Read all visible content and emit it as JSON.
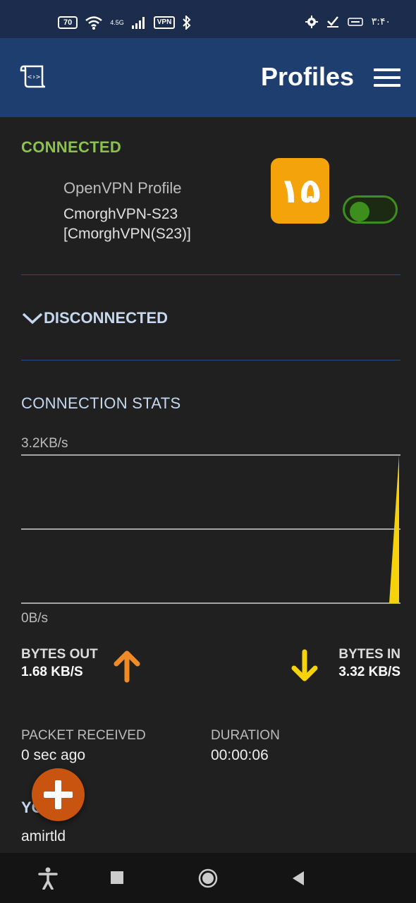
{
  "status_bar": {
    "battery": "70",
    "network": "4.5G",
    "vpn": "VPN",
    "time": "۳:۴۰"
  },
  "app_bar": {
    "title": "Profiles"
  },
  "connected_section": {
    "heading": "CONNECTED",
    "profile_type": "OpenVPN Profile",
    "profile_name": "CmorghVPN-S23 [CmorghVPN(S23)]",
    "badge_text": "۱۵",
    "toggle_on": true
  },
  "disconnected_section": {
    "heading": "DISCONNECTED"
  },
  "stats": {
    "heading": "CONNECTION STATS",
    "max_label": "3.2KB/s",
    "min_label": "0B/s",
    "bytes_out_label": "BYTES OUT",
    "bytes_out_value": "1.68 KB/S",
    "bytes_in_label": "BYTES IN",
    "bytes_in_value": "3.32 KB/S",
    "packet_label": "PACKET RECEIVED",
    "packet_value": "0 sec ago",
    "duration_label": "DURATION",
    "duration_value": "00:00:06"
  },
  "chart_data": {
    "type": "area",
    "ylim": [
      0,
      3.2
    ],
    "yunit": "KB/s",
    "series": [
      {
        "values": [
          0,
          0,
          0,
          0,
          0,
          0,
          0,
          0,
          0,
          0,
          0,
          0,
          0,
          0,
          0,
          0,
          0,
          0,
          0,
          0,
          0,
          0,
          0,
          0,
          0,
          0,
          0,
          0,
          0,
          3.32
        ],
        "color": "#f5d20a"
      }
    ]
  },
  "you_section": {
    "label": "YO",
    "username": "amirtld"
  },
  "colors": {
    "app_bar": "#1d3e6e",
    "connected": "#8bc34a",
    "badge": "#f5a30a",
    "bytes_out_arrow": "#f08a24",
    "bytes_in_arrow": "#f5d20a",
    "fab": "#c8540f"
  }
}
